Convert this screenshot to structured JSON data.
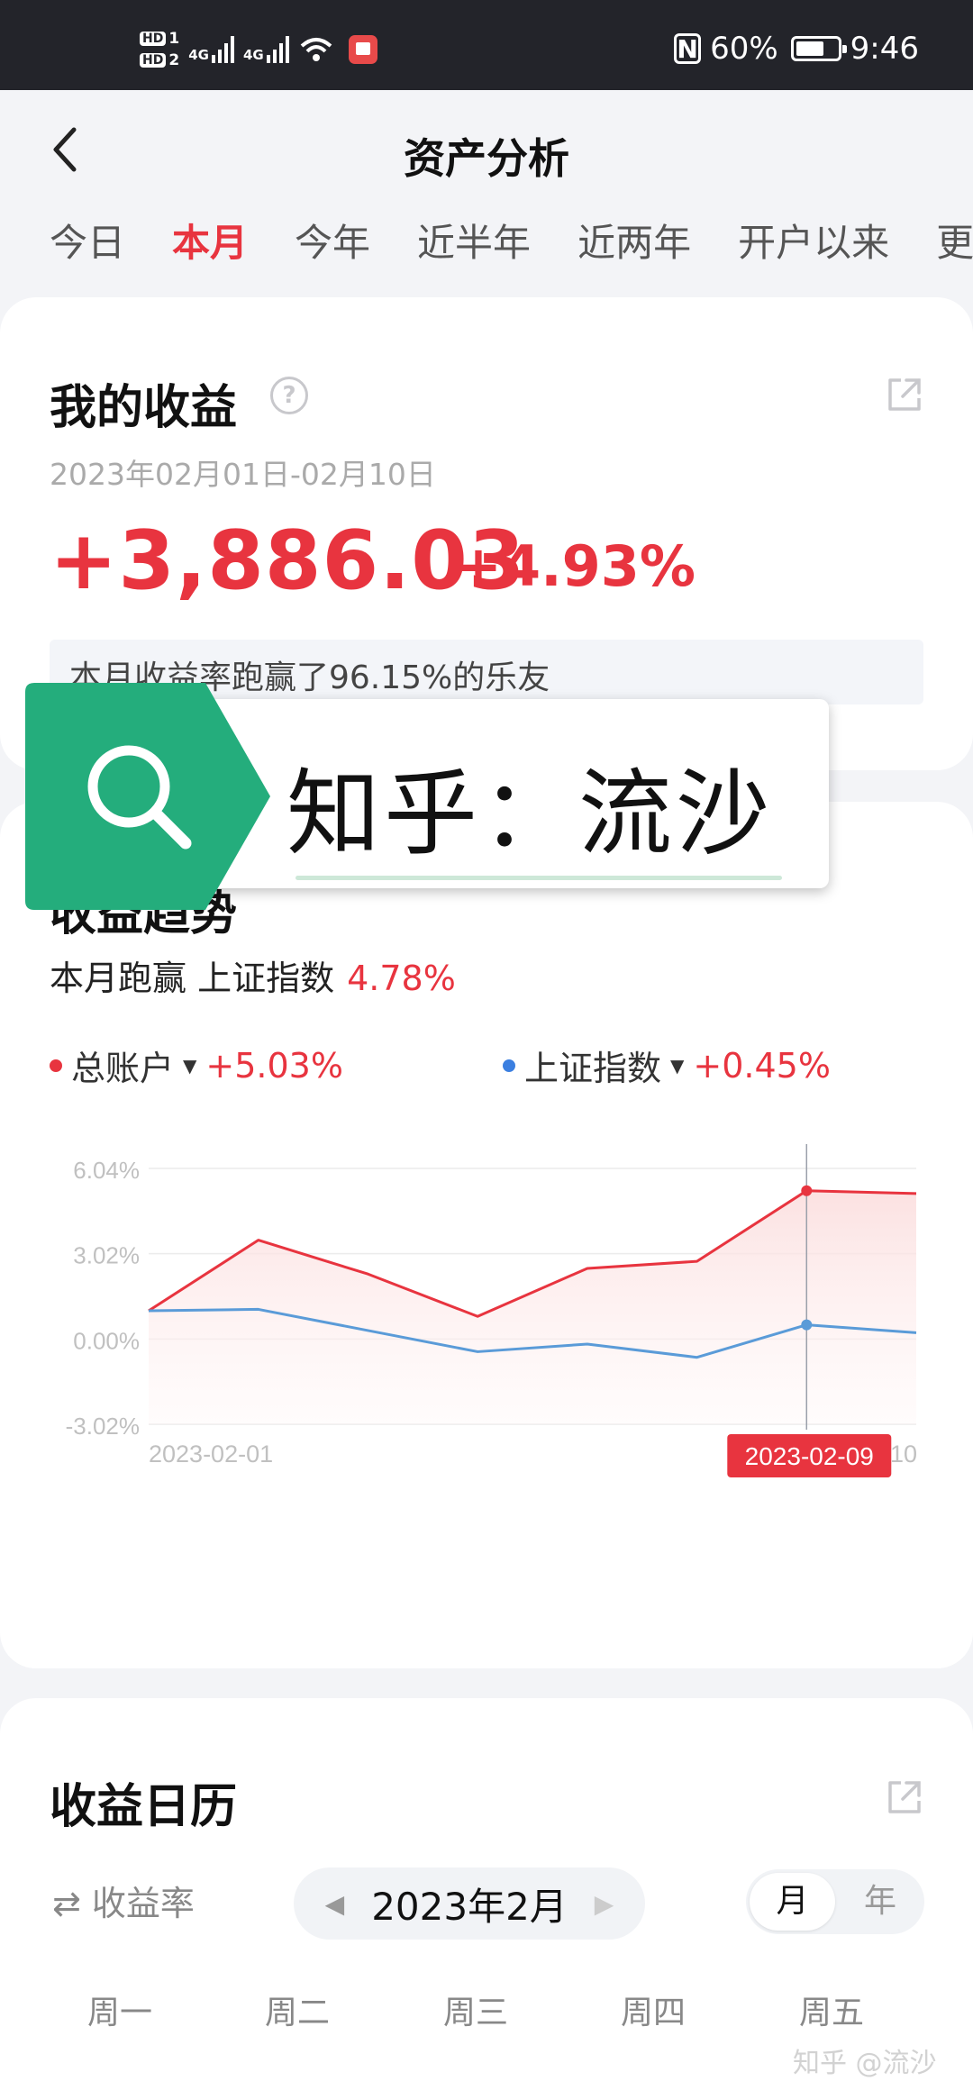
{
  "status_bar": {
    "hd1": "HD",
    "sim1": "1",
    "hd2": "HD",
    "sim2": "2",
    "net1": "4G",
    "net2": "4G",
    "nfc": "N",
    "battery": "60%",
    "time": "9:46"
  },
  "header": {
    "title": "资产分析"
  },
  "tabs": [
    "今日",
    "本月",
    "今年",
    "近半年",
    "近两年",
    "开户以来",
    "更"
  ],
  "active_tab": "本月",
  "earnings": {
    "title": "我的收益",
    "help_glyph": "?",
    "date_range": "2023年02月01日-02月10日",
    "amount": "+3,886.03",
    "percent": "+4.93%",
    "beat_text": "本月收益率跑赢了96.15%的乐友"
  },
  "overlay": {
    "text": "知乎：流沙"
  },
  "trend": {
    "title": "收益趋势",
    "beat_label": "本月跑赢 上证指数",
    "beat_value": "4.78%",
    "legend": [
      {
        "name": "总账户",
        "value": "+5.03%",
        "color": "#e8343f"
      },
      {
        "name": "上证指数",
        "value": "+0.45%",
        "color": "#3b7fe0"
      }
    ],
    "legend_arrow": "▼"
  },
  "chart_data": {
    "type": "line",
    "x": [
      "2023-02-01",
      "2023-02-02",
      "2023-02-03",
      "2023-02-06",
      "2023-02-07",
      "2023-02-08",
      "2023-02-09",
      "2023-02-10"
    ],
    "series": [
      {
        "name": "总账户",
        "values": [
          1.0,
          3.5,
          2.3,
          0.8,
          2.5,
          2.75,
          5.25,
          5.15
        ],
        "color": "#e8343f"
      },
      {
        "name": "上证指数",
        "values": [
          1.0,
          1.05,
          0.3,
          -0.45,
          -0.18,
          -0.65,
          0.5,
          0.22
        ],
        "color": "#5a9bd8"
      }
    ],
    "yticks": [
      "6.04%",
      "3.02%",
      "0.00%",
      "-3.02%"
    ],
    "ytick_values": [
      6.04,
      3.02,
      0.0,
      -3.02
    ],
    "ylim": [
      -3.02,
      6.04
    ],
    "x_label_start": "2023-02-01",
    "x_label_end": "2023-02-10",
    "highlight_label": "2023-02-09",
    "highlight_index": 6,
    "grid": true
  },
  "calendar": {
    "title": "收益日历",
    "rate_toggle": "⇄ 收益率",
    "month": "2023年2月",
    "prev_arrow": "◀",
    "next_arrow": "▶",
    "seg_month": "月",
    "seg_year": "年",
    "weekdays": [
      "周一",
      "周二",
      "周三",
      "周四",
      "周五"
    ]
  },
  "watermark": "知乎 @流沙"
}
